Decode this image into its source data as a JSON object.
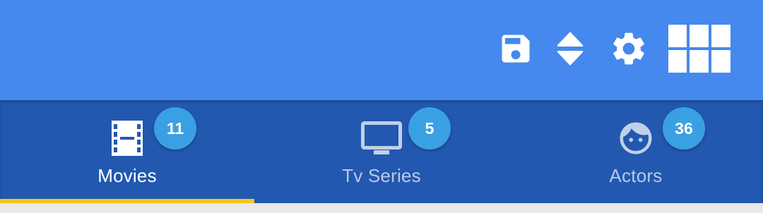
{
  "colors": {
    "toolbar": "#4589ee",
    "tabbar": "#2258b0",
    "badge": "#3aa0e4",
    "indicator": "#f5c518"
  },
  "toolbar": {
    "actions": [
      {
        "icon": "save-icon"
      },
      {
        "icon": "sort-icon"
      },
      {
        "icon": "settings-icon"
      },
      {
        "icon": "grid-view-icon"
      }
    ]
  },
  "tabs": [
    {
      "label": "Movies",
      "badge": "11",
      "icon": "movie-film-icon",
      "active": true
    },
    {
      "label": "Tv Series",
      "badge": "5",
      "icon": "tv-icon",
      "active": false
    },
    {
      "label": "Actors",
      "badge": "36",
      "icon": "face-icon",
      "active": false
    }
  ]
}
